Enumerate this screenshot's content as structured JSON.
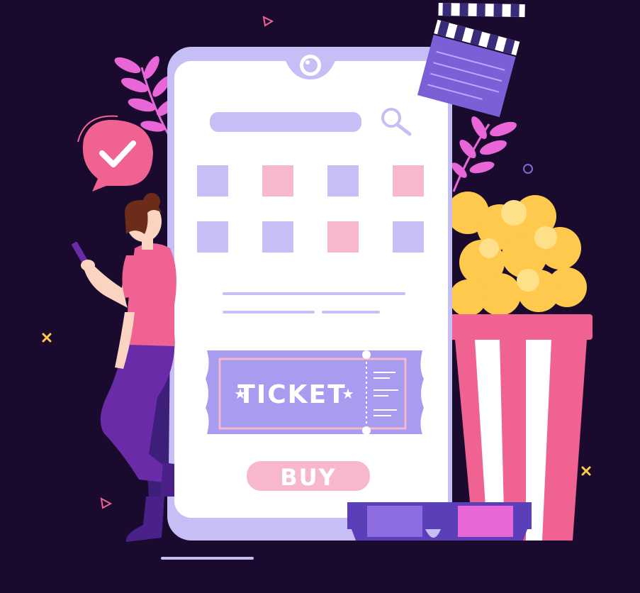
{
  "ticket": {
    "label": "TICKET"
  },
  "buy_button": {
    "label": "BUY"
  },
  "icons": {
    "search": "search-icon",
    "check": "check-icon",
    "clapperboard": "clapperboard-icon",
    "popcorn": "popcorn-icon",
    "glasses": "3d-glasses-icon",
    "star": "star-icon"
  },
  "colors": {
    "background": "#1a0b2e",
    "phone_frame": "#c5bff5",
    "phone_screen": "#ffffff",
    "accent_purple": "#a79cf0",
    "accent_pink": "#f7b8cc",
    "hot_pink": "#f06292",
    "popcorn_yellow": "#ffc94d"
  }
}
